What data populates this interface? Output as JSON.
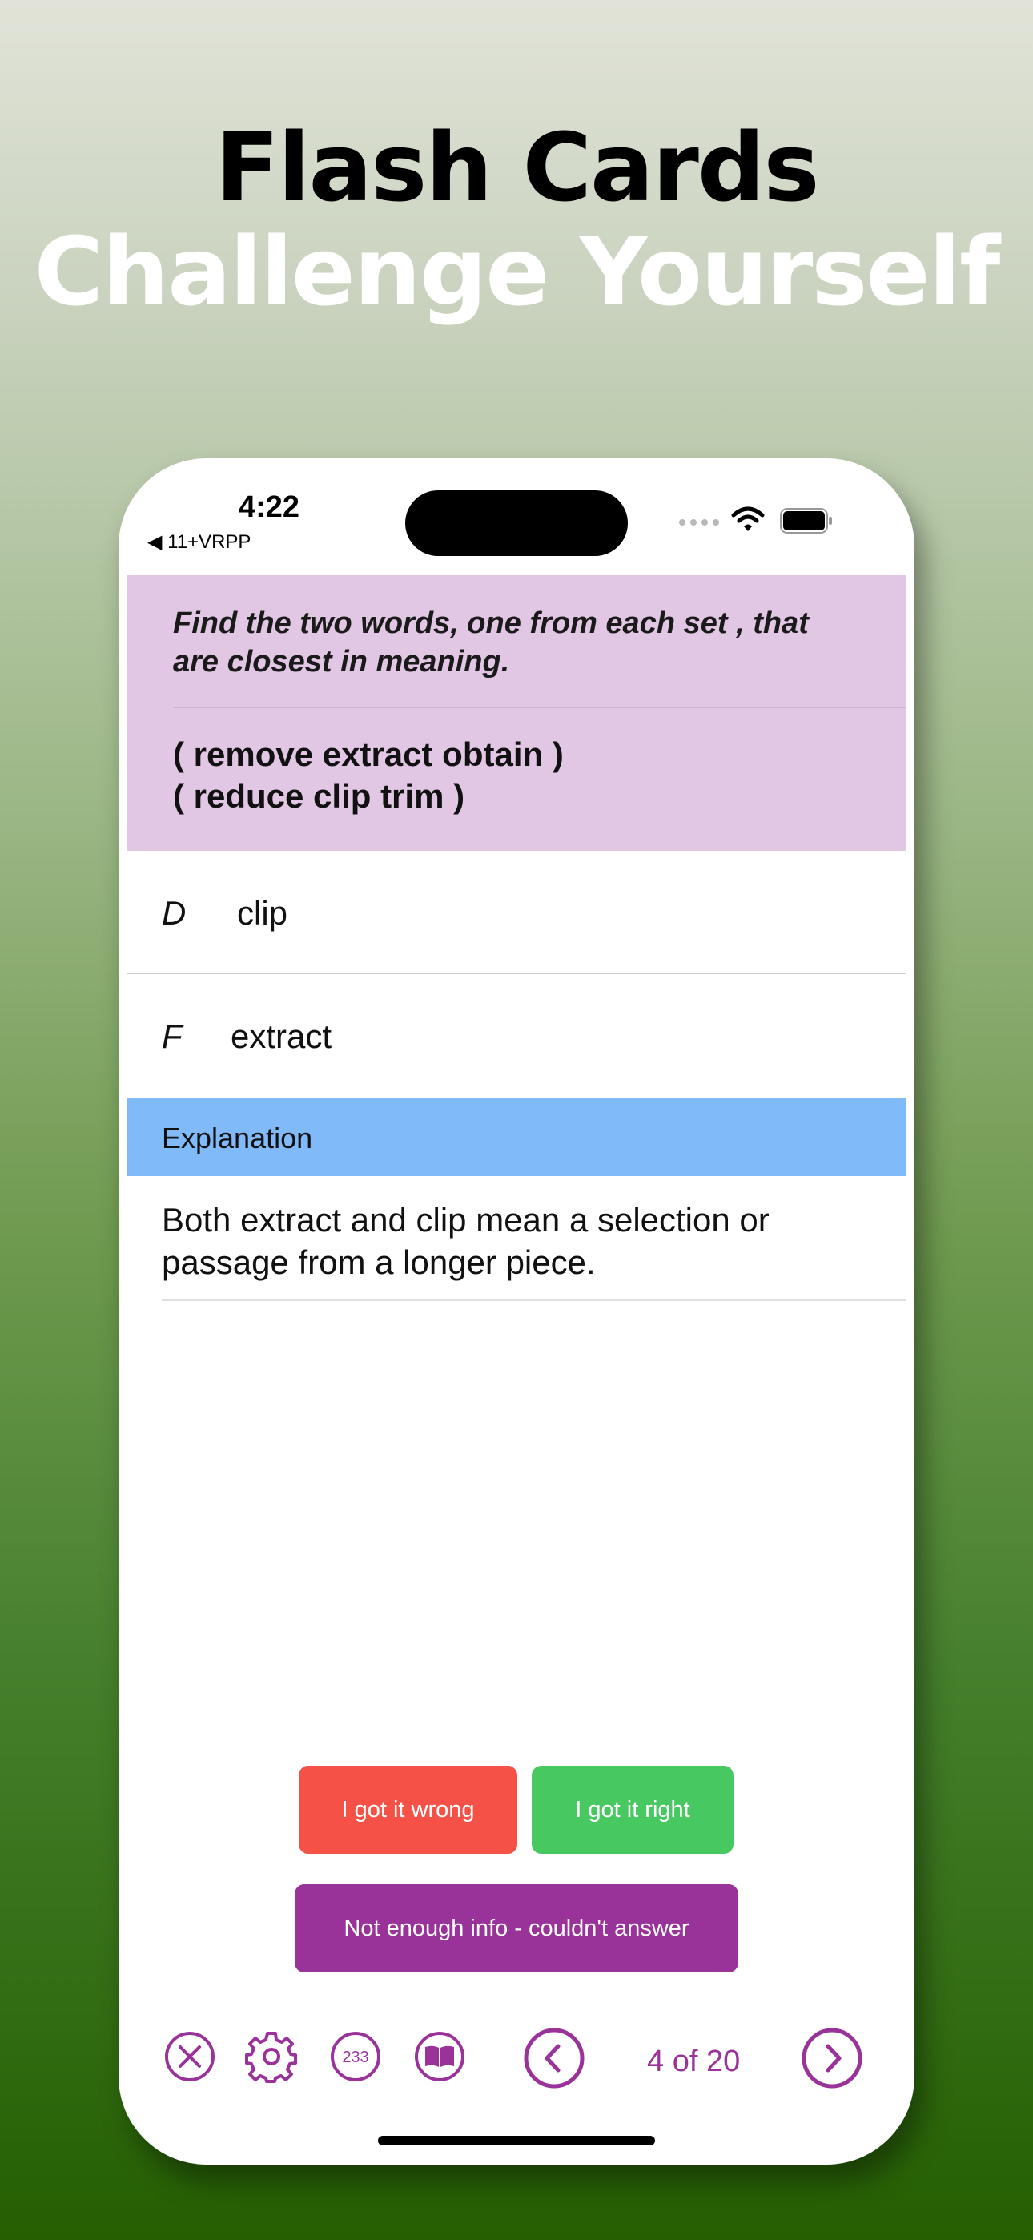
{
  "hero": {
    "line1": "Flash Cards",
    "line2": "Challenge Yourself"
  },
  "status_bar": {
    "time": "4:22",
    "back_label": "◀ 11+VRPP"
  },
  "question": {
    "prompt": "Find the two words, one from each set , that are closest in meaning.",
    "set1": "( remove extract obtain )",
    "set2": "( reduce clip trim )"
  },
  "answers": [
    {
      "letter": "D",
      "word": "clip"
    },
    {
      "letter": "F",
      "word": "extract"
    }
  ],
  "explanation": {
    "label": "Explanation",
    "text": "Both extract and clip mean a selection or passage from a longer piece."
  },
  "buttons": {
    "wrong": "I got it wrong",
    "right": "I got it right",
    "not_enough_info": "Not enough info - couldn't answer"
  },
  "toolbar": {
    "count_badge": "233",
    "page_indicator": "4 of 20"
  },
  "colors": {
    "accent": "#993399",
    "question_bg": "#e2c7e4",
    "explanation_bg": "#80baf9",
    "wrong": "#f55146",
    "right": "#48c860"
  }
}
